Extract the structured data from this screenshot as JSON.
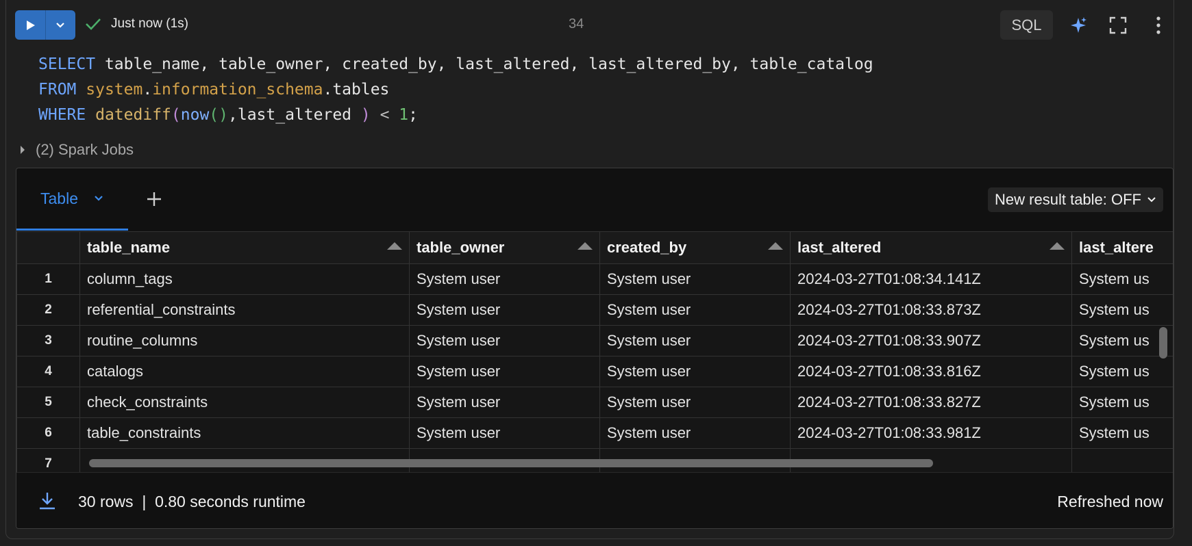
{
  "toolbar": {
    "status_text": "Just now (1s)",
    "line_count": "34",
    "language_label": "SQL"
  },
  "code": {
    "line1": {
      "kw": "SELECT",
      "rest": " table_name, table_owner, created_by, last_altered, last_altered_by, table_catalog"
    },
    "line2": {
      "kw": "FROM",
      "schema_a": "system",
      "dot1": ".",
      "schema_b": "information_schema",
      "dot2": ".",
      "table": "tables"
    },
    "line3": {
      "kw": "WHERE",
      "fn": "datediff",
      "p1": "(",
      "fn2": "now",
      "p2": "()",
      "rest": ",last_altered ",
      "p3": ")",
      "op": " < ",
      "num": "1",
      "semi": ";"
    }
  },
  "spark_jobs_label": "(2) Spark Jobs",
  "results": {
    "tab_label": "Table",
    "new_result_label": "New result table: OFF",
    "columns": [
      "table_name",
      "table_owner",
      "created_by",
      "last_altered",
      "last_altere"
    ],
    "rows": [
      {
        "n": "1",
        "table_name": "column_tags",
        "table_owner": "System user",
        "created_by": "System user",
        "last_altered": "2024-03-27T01:08:34.141Z",
        "last_altered_by": "System us"
      },
      {
        "n": "2",
        "table_name": "referential_constraints",
        "table_owner": "System user",
        "created_by": "System user",
        "last_altered": "2024-03-27T01:08:33.873Z",
        "last_altered_by": "System us"
      },
      {
        "n": "3",
        "table_name": "routine_columns",
        "table_owner": "System user",
        "created_by": "System user",
        "last_altered": "2024-03-27T01:08:33.907Z",
        "last_altered_by": "System us"
      },
      {
        "n": "4",
        "table_name": "catalogs",
        "table_owner": "System user",
        "created_by": "System user",
        "last_altered": "2024-03-27T01:08:33.816Z",
        "last_altered_by": "System us"
      },
      {
        "n": "5",
        "table_name": "check_constraints",
        "table_owner": "System user",
        "created_by": "System user",
        "last_altered": "2024-03-27T01:08:33.827Z",
        "last_altered_by": "System us"
      },
      {
        "n": "6",
        "table_name": "table_constraints",
        "table_owner": "System user",
        "created_by": "System user",
        "last_altered": "2024-03-27T01:08:33.981Z",
        "last_altered_by": "System us"
      },
      {
        "n": "7",
        "table_name": "",
        "table_owner": "",
        "created_by": "",
        "last_altered": "",
        "last_altered_by": ""
      }
    ],
    "footer_text": "30 rows  |  0.80 seconds runtime",
    "refreshed_text": "Refreshed now"
  },
  "colors": {
    "accent": "#2f7de1",
    "run_button": "#2f6fbf",
    "success": "#4caf6a",
    "background": "#1f1f1f",
    "grid_background": "#111111"
  },
  "icons": [
    "play-icon",
    "chevron-down-icon",
    "check-icon",
    "sparkle-icon",
    "expand-icon",
    "more-vertical-icon",
    "caret-right-icon",
    "plus-icon",
    "sort-icon",
    "download-icon"
  ]
}
